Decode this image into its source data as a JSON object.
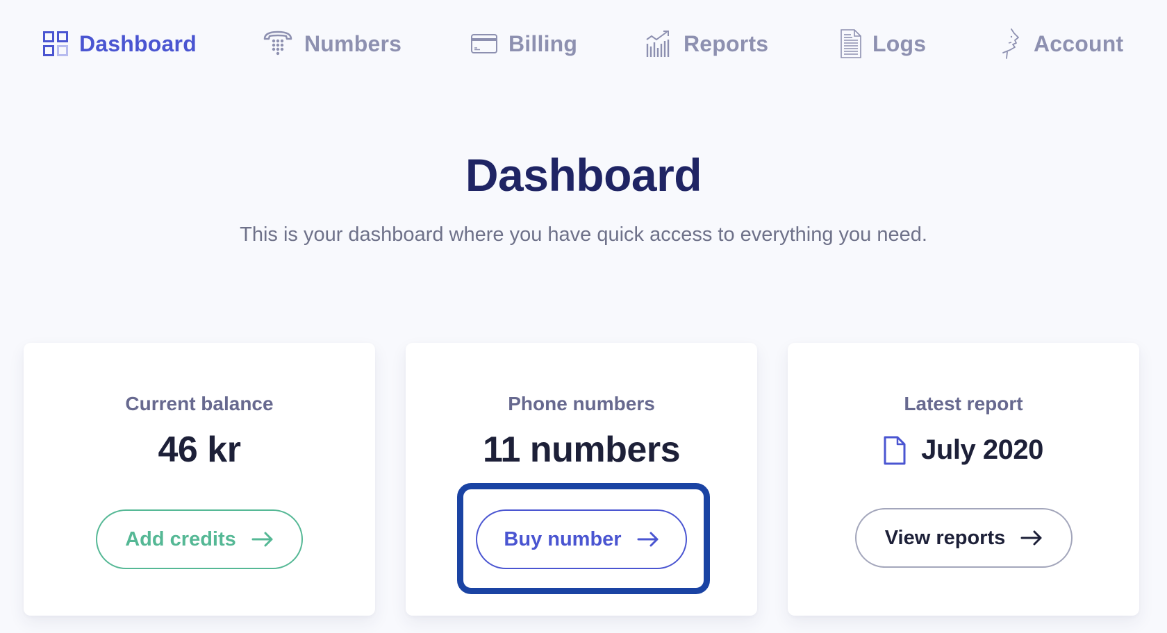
{
  "nav": {
    "items": [
      {
        "label": "Dashboard",
        "icon": "grid-icon",
        "active": true
      },
      {
        "label": "Numbers",
        "icon": "telephone-icon",
        "active": false
      },
      {
        "label": "Billing",
        "icon": "credit-card-icon",
        "active": false
      },
      {
        "label": "Reports",
        "icon": "chart-icon",
        "active": false
      },
      {
        "label": "Logs",
        "icon": "document-lines-icon",
        "active": false
      },
      {
        "label": "Account",
        "icon": "face-profile-icon",
        "active": false
      }
    ]
  },
  "header": {
    "title": "Dashboard",
    "subtitle": "This is your dashboard where you have quick access to everything you need."
  },
  "cards": [
    {
      "label": "Current balance",
      "value": "46 kr",
      "button": "Add credits",
      "button_icon": "arrow-right-icon"
    },
    {
      "label": "Phone numbers",
      "value": "11 numbers",
      "button": "Buy number",
      "button_icon": "arrow-right-icon"
    },
    {
      "label": "Latest report",
      "value": "July 2020",
      "value_icon": "document-icon",
      "button": "View reports",
      "button_icon": "arrow-right-icon"
    }
  ],
  "colors": {
    "accent": "#4a55d1",
    "nav_inactive": "#8d90b0",
    "title": "#1f2464",
    "success": "#55b895",
    "highlight": "#1a43a3"
  }
}
